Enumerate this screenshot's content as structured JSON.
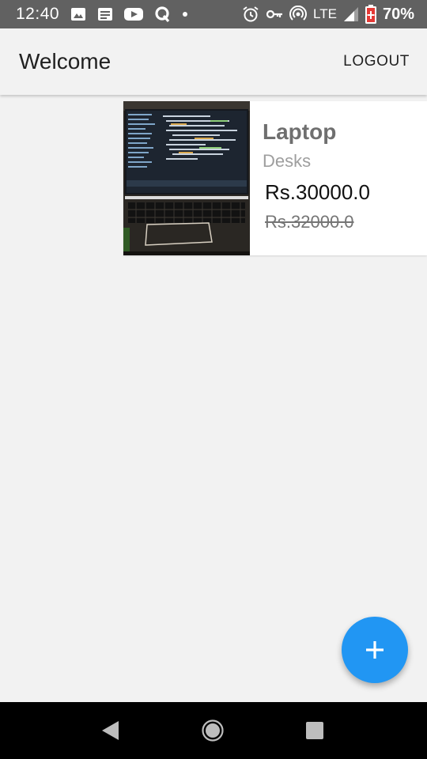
{
  "status_bar": {
    "time": "12:40",
    "network": "LTE",
    "battery": "70%",
    "icons": [
      "image-icon",
      "news-icon",
      "youtube-icon",
      "q-icon",
      "dot-icon",
      "alarm-icon",
      "vpn-key-icon",
      "hotspot-icon",
      "signal-icon",
      "battery-icon"
    ]
  },
  "app_bar": {
    "title": "Welcome",
    "logout_label": "LOGOUT"
  },
  "products": [
    {
      "name": "Laptop",
      "category": "Desks",
      "price": "Rs.30000.0",
      "original_price": "Rs.32000.0"
    }
  ],
  "fab": {
    "icon": "add-icon",
    "color": "#2196f3"
  },
  "nav_bar": {
    "icons": [
      "back-icon",
      "home-icon",
      "recents-icon"
    ]
  },
  "colors": {
    "status_bar": "#616161",
    "background": "#f2f2f2",
    "accent": "#2196f3",
    "nav_bar": "#000000"
  }
}
